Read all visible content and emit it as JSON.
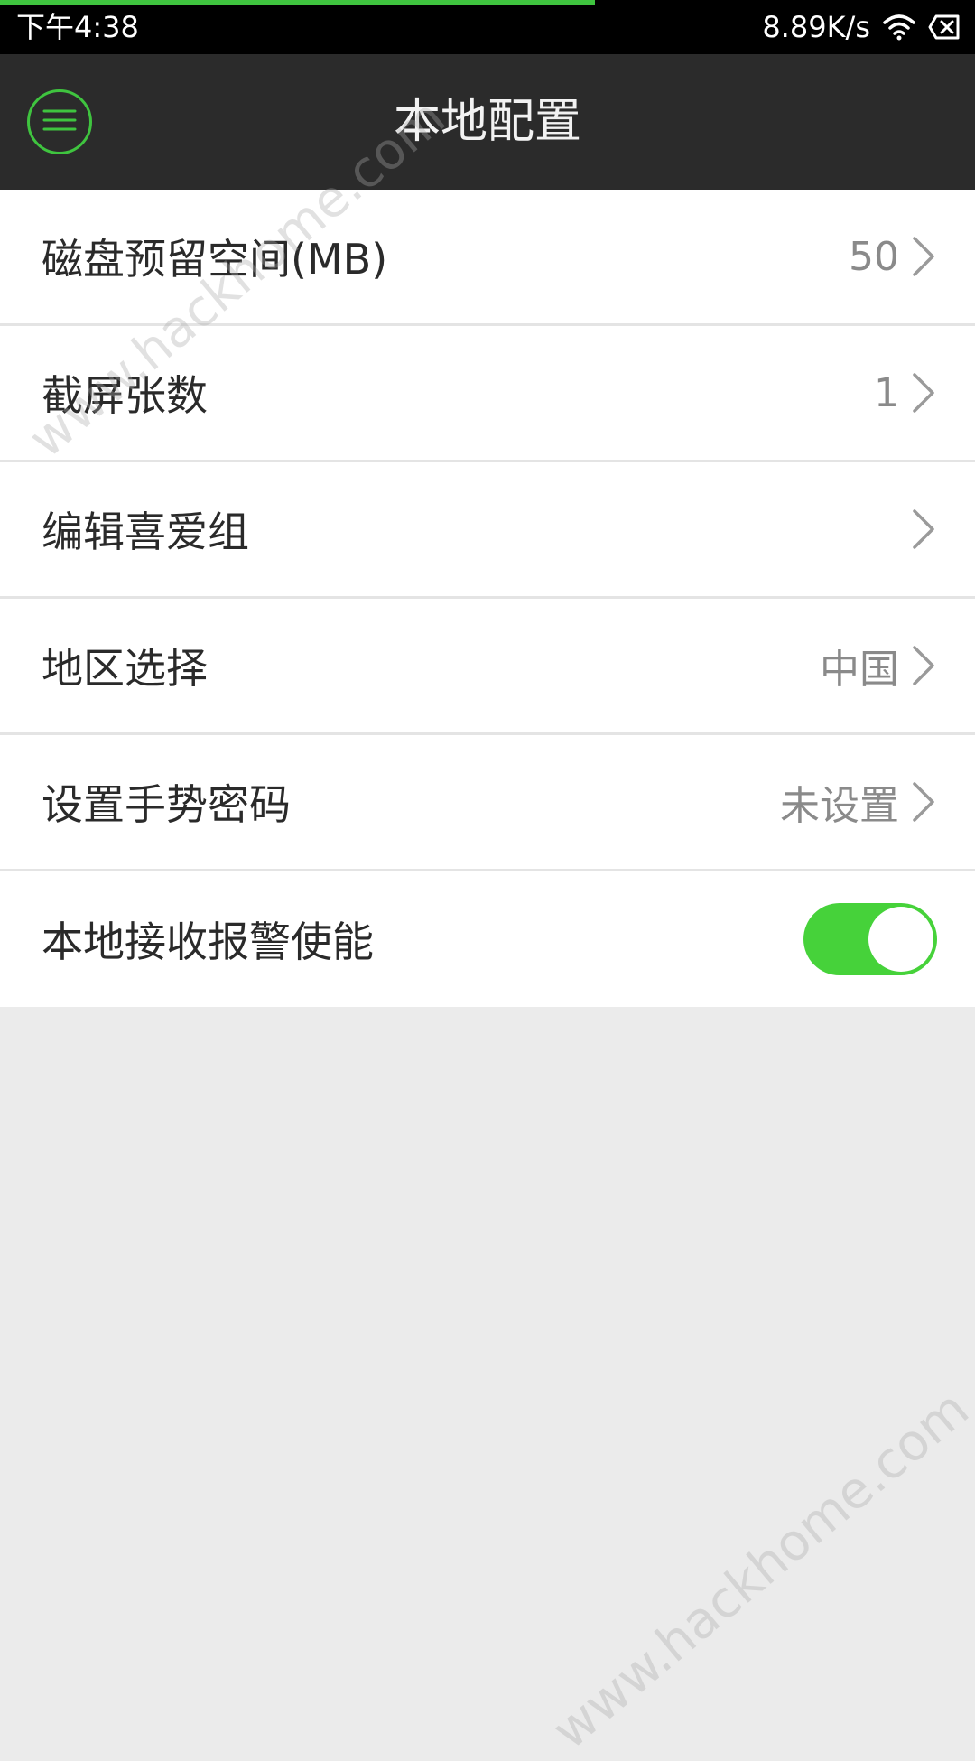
{
  "status_bar": {
    "time": "下午4:38",
    "network_speed": "8.89K/s",
    "wifi_icon": "wifi-icon",
    "battery_icon": "battery-icon",
    "load_progress": 0.61,
    "progress_color": "#3fc43f"
  },
  "header": {
    "title": "本地配置",
    "menu_icon": "menu-icon",
    "accent_color": "#3fc43f",
    "background_color": "#2b2b2b"
  },
  "settings": [
    {
      "label": "磁盘预留空间(MB)",
      "value": "50",
      "icon": "chevron-right-icon"
    },
    {
      "label": "截屏张数",
      "value": "1",
      "icon": "chevron-right-icon"
    },
    {
      "label": "编辑喜爱组",
      "value": "",
      "icon": "chevron-right-icon"
    },
    {
      "label": "地区选择",
      "value": "中国",
      "icon": "chevron-right-icon"
    },
    {
      "label": "设置手势密码",
      "value": "未设置",
      "icon": "chevron-right-icon"
    },
    {
      "label": "本地接收报警使能",
      "toggle_on": true,
      "toggle_color": "#46d23a"
    }
  ],
  "watermark": {
    "text_top": "www.hackhome.com",
    "text_bottom": "www.hackhome.com"
  }
}
